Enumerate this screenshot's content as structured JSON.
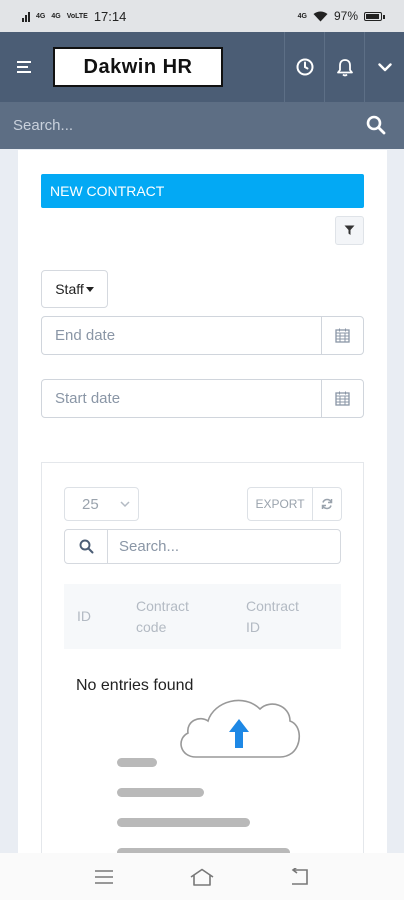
{
  "status_bar": {
    "network_1": "4G",
    "network_2": "4G",
    "network_3": "VoLTE",
    "time": "17:14",
    "right_badge": "4G",
    "battery_percent": "97%",
    "battery_level": 0.97
  },
  "header": {
    "logo_text": "Dakwin HR",
    "menu_icon": "menu-icon",
    "icons": [
      "clock-icon",
      "bell-icon",
      "chevron-down-icon"
    ]
  },
  "search": {
    "placeholder": "Search..."
  },
  "main": {
    "new_contract_label": "NEW CONTRACT",
    "filter_icon": "filter-icon",
    "staff_label": "Staff",
    "end_date_placeholder": "End date",
    "start_date_placeholder": "Start date"
  },
  "table": {
    "page_size": "25",
    "export_label": "EXPORT",
    "search_placeholder": "Search...",
    "columns": [
      {
        "line1": "ID",
        "line2": ""
      },
      {
        "line1": "Contract",
        "line2": "code"
      },
      {
        "line1": "Contract",
        "line2": "ID"
      }
    ],
    "empty_message": "No entries found"
  },
  "colors": {
    "header_bg": "#4b5d75",
    "search_bg": "#5d6e84",
    "primary_button": "#03a9f4",
    "upload_arrow": "#1e88e5"
  }
}
